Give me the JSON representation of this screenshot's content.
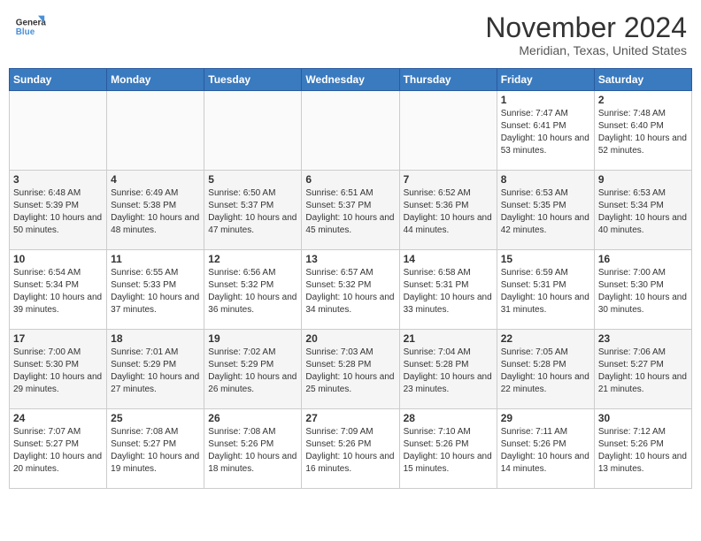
{
  "logo": {
    "line1": "General",
    "line2": "Blue"
  },
  "title": "November 2024",
  "subtitle": "Meridian, Texas, United States",
  "weekdays": [
    "Sunday",
    "Monday",
    "Tuesday",
    "Wednesday",
    "Thursday",
    "Friday",
    "Saturday"
  ],
  "weeks": [
    [
      {
        "day": "",
        "info": ""
      },
      {
        "day": "",
        "info": ""
      },
      {
        "day": "",
        "info": ""
      },
      {
        "day": "",
        "info": ""
      },
      {
        "day": "",
        "info": ""
      },
      {
        "day": "1",
        "info": "Sunrise: 7:47 AM\nSunset: 6:41 PM\nDaylight: 10 hours and 53 minutes."
      },
      {
        "day": "2",
        "info": "Sunrise: 7:48 AM\nSunset: 6:40 PM\nDaylight: 10 hours and 52 minutes."
      }
    ],
    [
      {
        "day": "3",
        "info": "Sunrise: 6:48 AM\nSunset: 5:39 PM\nDaylight: 10 hours and 50 minutes."
      },
      {
        "day": "4",
        "info": "Sunrise: 6:49 AM\nSunset: 5:38 PM\nDaylight: 10 hours and 48 minutes."
      },
      {
        "day": "5",
        "info": "Sunrise: 6:50 AM\nSunset: 5:37 PM\nDaylight: 10 hours and 47 minutes."
      },
      {
        "day": "6",
        "info": "Sunrise: 6:51 AM\nSunset: 5:37 PM\nDaylight: 10 hours and 45 minutes."
      },
      {
        "day": "7",
        "info": "Sunrise: 6:52 AM\nSunset: 5:36 PM\nDaylight: 10 hours and 44 minutes."
      },
      {
        "day": "8",
        "info": "Sunrise: 6:53 AM\nSunset: 5:35 PM\nDaylight: 10 hours and 42 minutes."
      },
      {
        "day": "9",
        "info": "Sunrise: 6:53 AM\nSunset: 5:34 PM\nDaylight: 10 hours and 40 minutes."
      }
    ],
    [
      {
        "day": "10",
        "info": "Sunrise: 6:54 AM\nSunset: 5:34 PM\nDaylight: 10 hours and 39 minutes."
      },
      {
        "day": "11",
        "info": "Sunrise: 6:55 AM\nSunset: 5:33 PM\nDaylight: 10 hours and 37 minutes."
      },
      {
        "day": "12",
        "info": "Sunrise: 6:56 AM\nSunset: 5:32 PM\nDaylight: 10 hours and 36 minutes."
      },
      {
        "day": "13",
        "info": "Sunrise: 6:57 AM\nSunset: 5:32 PM\nDaylight: 10 hours and 34 minutes."
      },
      {
        "day": "14",
        "info": "Sunrise: 6:58 AM\nSunset: 5:31 PM\nDaylight: 10 hours and 33 minutes."
      },
      {
        "day": "15",
        "info": "Sunrise: 6:59 AM\nSunset: 5:31 PM\nDaylight: 10 hours and 31 minutes."
      },
      {
        "day": "16",
        "info": "Sunrise: 7:00 AM\nSunset: 5:30 PM\nDaylight: 10 hours and 30 minutes."
      }
    ],
    [
      {
        "day": "17",
        "info": "Sunrise: 7:00 AM\nSunset: 5:30 PM\nDaylight: 10 hours and 29 minutes."
      },
      {
        "day": "18",
        "info": "Sunrise: 7:01 AM\nSunset: 5:29 PM\nDaylight: 10 hours and 27 minutes."
      },
      {
        "day": "19",
        "info": "Sunrise: 7:02 AM\nSunset: 5:29 PM\nDaylight: 10 hours and 26 minutes."
      },
      {
        "day": "20",
        "info": "Sunrise: 7:03 AM\nSunset: 5:28 PM\nDaylight: 10 hours and 25 minutes."
      },
      {
        "day": "21",
        "info": "Sunrise: 7:04 AM\nSunset: 5:28 PM\nDaylight: 10 hours and 23 minutes."
      },
      {
        "day": "22",
        "info": "Sunrise: 7:05 AM\nSunset: 5:28 PM\nDaylight: 10 hours and 22 minutes."
      },
      {
        "day": "23",
        "info": "Sunrise: 7:06 AM\nSunset: 5:27 PM\nDaylight: 10 hours and 21 minutes."
      }
    ],
    [
      {
        "day": "24",
        "info": "Sunrise: 7:07 AM\nSunset: 5:27 PM\nDaylight: 10 hours and 20 minutes."
      },
      {
        "day": "25",
        "info": "Sunrise: 7:08 AM\nSunset: 5:27 PM\nDaylight: 10 hours and 19 minutes."
      },
      {
        "day": "26",
        "info": "Sunrise: 7:08 AM\nSunset: 5:26 PM\nDaylight: 10 hours and 18 minutes."
      },
      {
        "day": "27",
        "info": "Sunrise: 7:09 AM\nSunset: 5:26 PM\nDaylight: 10 hours and 16 minutes."
      },
      {
        "day": "28",
        "info": "Sunrise: 7:10 AM\nSunset: 5:26 PM\nDaylight: 10 hours and 15 minutes."
      },
      {
        "day": "29",
        "info": "Sunrise: 7:11 AM\nSunset: 5:26 PM\nDaylight: 10 hours and 14 minutes."
      },
      {
        "day": "30",
        "info": "Sunrise: 7:12 AM\nSunset: 5:26 PM\nDaylight: 10 hours and 13 minutes."
      }
    ]
  ]
}
